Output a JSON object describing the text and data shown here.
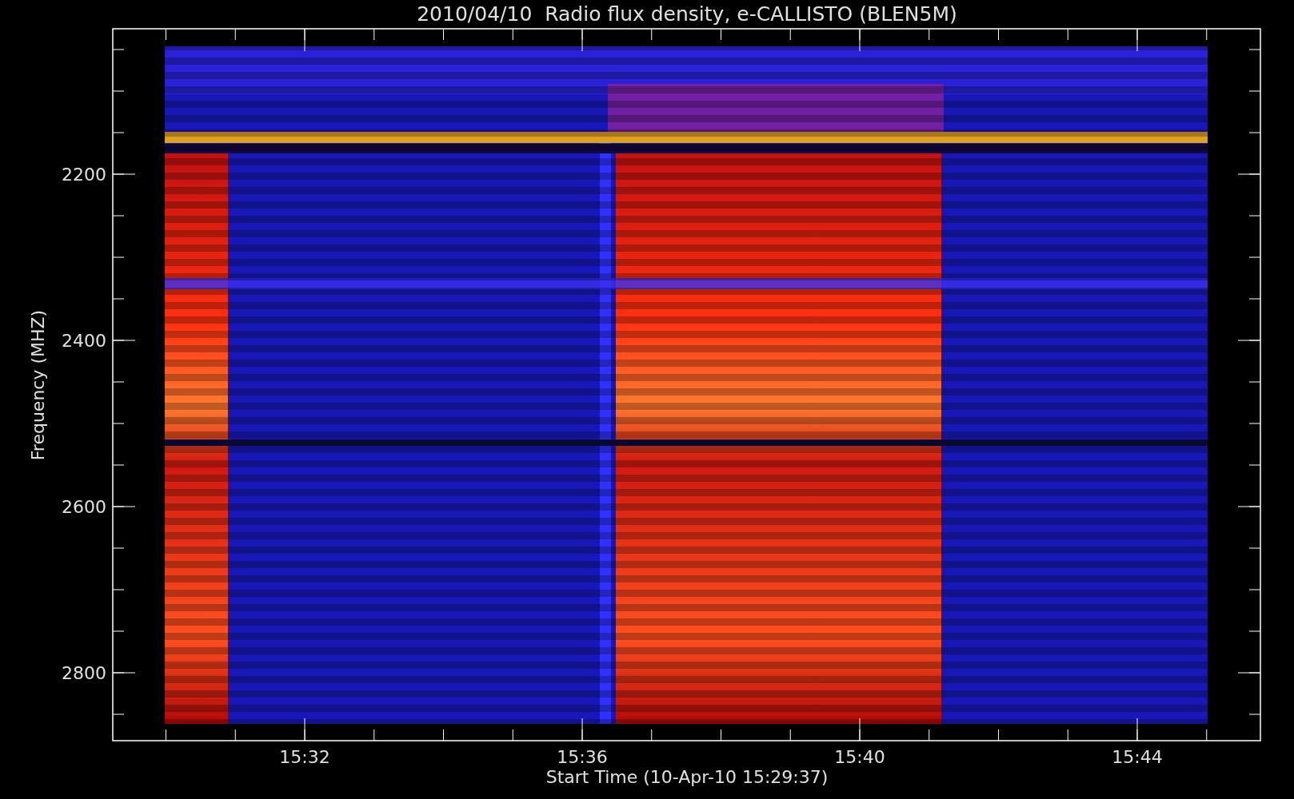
{
  "title": "2010/04/10  Radio flux density, e-CALLISTO (BLEN5M)",
  "y_axis": {
    "label": "Frequency (MHZ)",
    "ticks": [
      "2200",
      "2400",
      "2600",
      "2800"
    ]
  },
  "x_axis": {
    "label": "Start Time (10-Apr-10 15:29:37)",
    "ticks": [
      "15:32",
      "15:36",
      "15:40",
      "15:44"
    ]
  }
}
